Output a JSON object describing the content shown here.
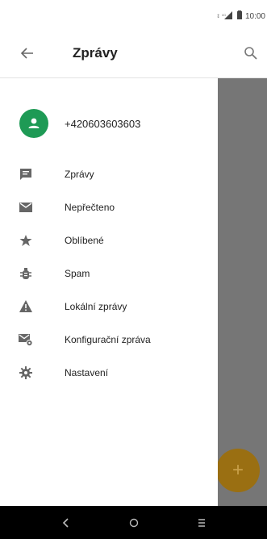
{
  "status_bar": {
    "time": "10:00"
  },
  "app_bar": {
    "title": "Zprávy",
    "back_icon": "arrow-left-icon",
    "search_icon": "search-icon"
  },
  "drawer": {
    "account": {
      "phone_number": "+420603603603",
      "avatar_icon": "person-icon",
      "avatar_color": "#1e9a55"
    },
    "items": [
      {
        "label": "Zprávy",
        "icon": "message-icon"
      },
      {
        "label": "Nepřečteno",
        "icon": "mail-icon"
      },
      {
        "label": "Oblíbené",
        "icon": "star-icon"
      },
      {
        "label": "Spam",
        "icon": "bug-icon"
      },
      {
        "label": "Lokální zprávy",
        "icon": "warning-icon"
      },
      {
        "label": "Konfigurační zpráva",
        "icon": "mail-settings-icon"
      },
      {
        "label": "Nastavení",
        "icon": "gear-icon"
      }
    ]
  },
  "fab": {
    "icon": "plus-icon",
    "color": "#9a6f12"
  },
  "nav_bar": {
    "back_icon": "nav-back-icon",
    "home_icon": "nav-home-icon",
    "recents_icon": "nav-recents-icon"
  }
}
